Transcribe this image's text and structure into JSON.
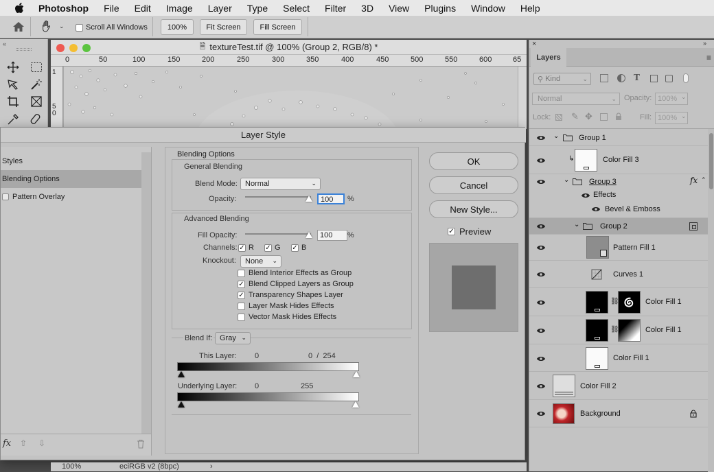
{
  "menubar": {
    "app_name": "Photoshop",
    "items": [
      "File",
      "Edit",
      "Image",
      "Layer",
      "Type",
      "Select",
      "Filter",
      "3D",
      "View",
      "Plugins",
      "Window",
      "Help"
    ]
  },
  "options_bar": {
    "scroll_all_windows": "Scroll All Windows",
    "btn_100": "100%",
    "btn_fit": "Fit Screen",
    "btn_fill": "Fill Screen"
  },
  "document": {
    "title": "textureTest.tif @ 100% (Group 2, RGB/8) *",
    "ruler_ticks": [
      "0",
      "50",
      "100",
      "150",
      "200",
      "250",
      "300",
      "350",
      "400",
      "450",
      "500",
      "550",
      "600",
      "65"
    ],
    "vruler_ticks": [
      "1",
      "5",
      "0"
    ]
  },
  "status_bar": {
    "zoom": "100%",
    "profile": "eciRGB v2 (8bpc)",
    "arrow": "›"
  },
  "dialog": {
    "title": "Layer Style",
    "styles_list": [
      "Styles",
      "Blending Options",
      "Pattern Overlay"
    ],
    "blending_options_header": "Blending Options",
    "general_blending": "General Blending",
    "blend_mode_label": "Blend Mode:",
    "blend_mode_value": "Normal",
    "opacity_label": "Opacity:",
    "opacity_value": "100",
    "pct": "%",
    "advanced_blending": "Advanced Blending",
    "fill_opacity_label": "Fill Opacity:",
    "fill_opacity_value": "100",
    "channels_label": "Channels:",
    "channels": [
      "R",
      "G",
      "B"
    ],
    "knockout_label": "Knockout:",
    "knockout_value": "None",
    "checks": [
      {
        "label": "Blend Interior Effects as Group",
        "checked": false
      },
      {
        "label": "Blend Clipped Layers as Group",
        "checked": true
      },
      {
        "label": "Transparency Shapes Layer",
        "checked": true
      },
      {
        "label": "Layer Mask Hides Effects",
        "checked": false
      },
      {
        "label": "Vector Mask Hides Effects",
        "checked": false
      }
    ],
    "blend_if_label": "Blend If:",
    "blend_if_value": "Gray",
    "this_layer_label": "This Layer:",
    "this_layer_low": "0",
    "this_layer_high": "0  /  254",
    "underlying_label": "Underlying Layer:",
    "underlying_low": "0",
    "underlying_high": "255",
    "ok": "OK",
    "cancel": "Cancel",
    "new_style": "New Style...",
    "preview_label": "Preview",
    "preview_checked": true,
    "fx": "fx"
  },
  "layers_panel": {
    "tab": "Layers",
    "kind": "Kind",
    "blend": "Normal",
    "opacity_label": "Opacity:",
    "opacity_value": "100%",
    "lock_label": "Lock:",
    "fill_label": "Fill:",
    "fill_value": "100%",
    "layers": [
      {
        "name": "Group 1"
      },
      {
        "name": "Color Fill 3"
      },
      {
        "name": "Group 3"
      },
      {
        "name": "Effects"
      },
      {
        "name": "Bevel & Emboss"
      },
      {
        "name": "Group 2"
      },
      {
        "name": "Pattern Fill 1"
      },
      {
        "name": "Curves 1"
      },
      {
        "name": "Color Fill 1"
      },
      {
        "name": "Color Fill 1"
      },
      {
        "name": "Color Fill 1"
      },
      {
        "name": "Color Fill 2"
      },
      {
        "name": "Background"
      }
    ]
  }
}
